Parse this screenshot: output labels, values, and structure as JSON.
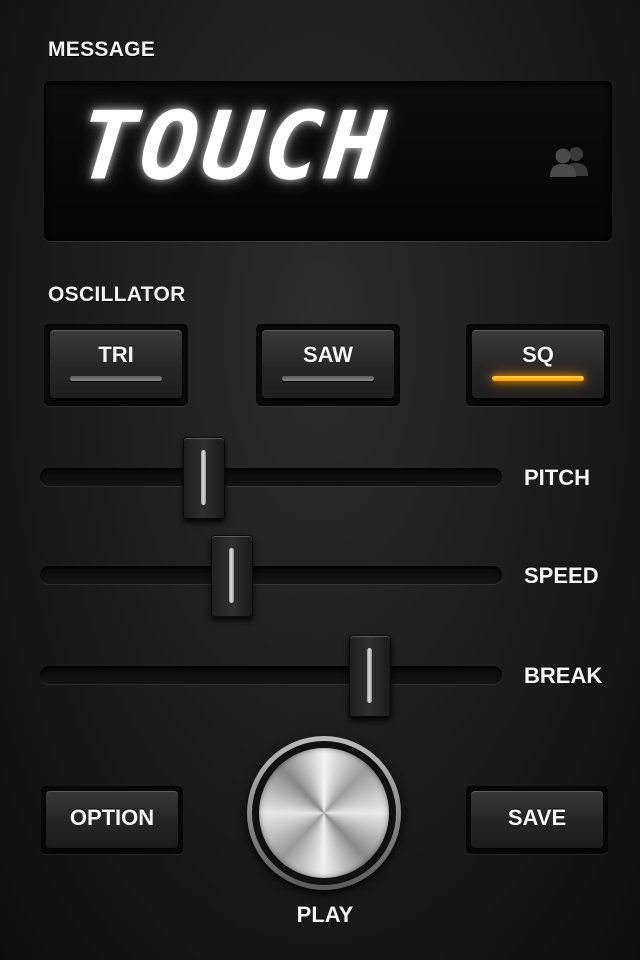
{
  "message": {
    "section_label": "MESSAGE",
    "display_text": "TOUCH",
    "icon": "users-icon"
  },
  "oscillator": {
    "section_label": "OSCILLATOR",
    "options": [
      {
        "label": "TRI",
        "active": false
      },
      {
        "label": "SAW",
        "active": false
      },
      {
        "label": "SQ",
        "active": true
      }
    ],
    "active_color": "#ffa800"
  },
  "sliders": {
    "pitch": {
      "label": "PITCH",
      "value": 0.35
    },
    "speed": {
      "label": "SPEED",
      "value": 0.41
    },
    "break": {
      "label": "BREAK",
      "value": 0.73
    }
  },
  "buttons": {
    "option_label": "OPTION",
    "save_label": "SAVE",
    "play_label": "PLAY"
  }
}
